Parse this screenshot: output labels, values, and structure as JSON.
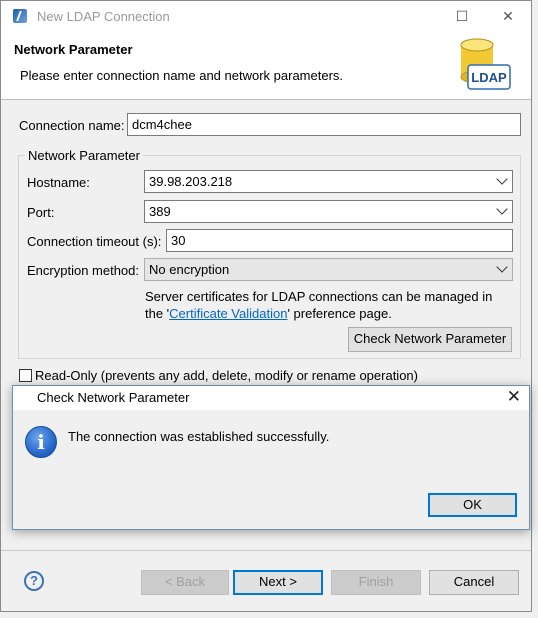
{
  "window": {
    "title": "New LDAP Connection"
  },
  "header": {
    "title": "Network Parameter",
    "description": "Please enter connection name and network parameters.",
    "icon_label": "LDAP"
  },
  "form": {
    "connection_name_label": "Connection name:",
    "connection_name_value": "dcm4chee",
    "group_title": "Network Parameter",
    "hostname_label": "Hostname:",
    "hostname_value": "39.98.203.218",
    "port_label": "Port:",
    "port_value": "389",
    "timeout_label": "Connection timeout (s):",
    "timeout_value": "30",
    "encryption_label": "Encryption method:",
    "encryption_value": "No encryption",
    "cert_info_line1": "Server certificates for LDAP connections can be managed in",
    "cert_info_prefix": "the '",
    "cert_link": "Certificate Validation",
    "cert_info_suffix": "' preference page.",
    "check_button": "Check Network Parameter",
    "readonly_label": "Read-Only (prevents any add, delete, modify or rename operation)"
  },
  "footer": {
    "back_button": "< Back",
    "next_button": "Next >",
    "finish_button": "Finish",
    "cancel_button": "Cancel"
  },
  "dialog": {
    "title": "Check Network Parameter",
    "message": "The connection was established successfully.",
    "ok_button": "OK"
  },
  "icons": {
    "app": "eclipse-ldap-icon",
    "header": "ldap-database-icon",
    "info": "info-icon",
    "help": "help-icon"
  },
  "colors": {
    "link": "#0066cc",
    "focus": "#0078d7",
    "info_icon": "#1e5fc2"
  }
}
